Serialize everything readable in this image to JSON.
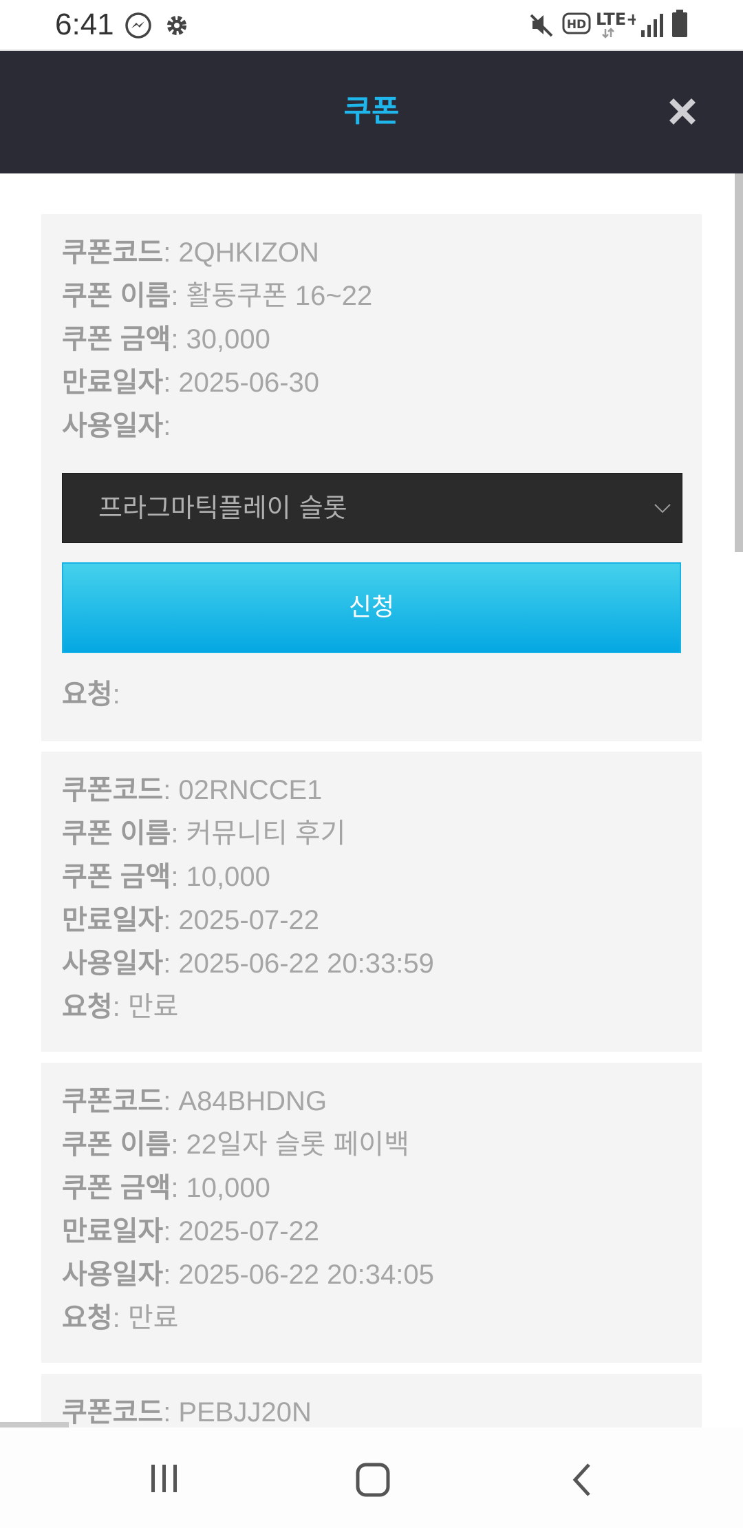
{
  "status_bar": {
    "time": "6:41",
    "icons": [
      "messenger-icon",
      "gear-icon",
      "mute-icon",
      "hd-icon",
      "lte-icon",
      "signal-icon",
      "battery-icon"
    ],
    "lte": "LTE+",
    "hd": "HD"
  },
  "header": {
    "title": "쿠폰",
    "close_icon": "close-icon"
  },
  "labels": {
    "code": "쿠폰코드",
    "name": "쿠폰 이름",
    "amount": "쿠폰 금액",
    "expiry": "만료일자",
    "used": "사용일자",
    "request": "요청"
  },
  "coupons": [
    {
      "code": ": 2QHKIZON",
      "name": ": 활동쿠폰 16~22",
      "amount": ": 30,000",
      "expiry": ": 2025-06-30",
      "used": ":",
      "request": ":",
      "select_value": "프라그마틱플레이 슬롯",
      "apply_label": "신청"
    },
    {
      "code": ": 02RNCCE1",
      "name": ": 커뮤니티 후기",
      "amount": ": 10,000",
      "expiry": ": 2025-07-22",
      "used": ": 2025-06-22 20:33:59",
      "request": ": 만료"
    },
    {
      "code": ": A84BHDNG",
      "name": ": 22일자 슬롯 페이백",
      "amount": ": 10,000",
      "expiry": ": 2025-07-22",
      "used": ": 2025-06-22 20:34:05",
      "request": ": 만료"
    },
    {
      "code": ": PEBJJ20N"
    }
  ],
  "nav_bar": {
    "icons": [
      "recent-apps-icon",
      "home-icon",
      "back-icon"
    ]
  },
  "colors": {
    "header_bg": "#2b2b35",
    "accent": "#1fb6ec",
    "card_bg": "#f4f4f4",
    "select_bg": "#2b2b2b"
  }
}
